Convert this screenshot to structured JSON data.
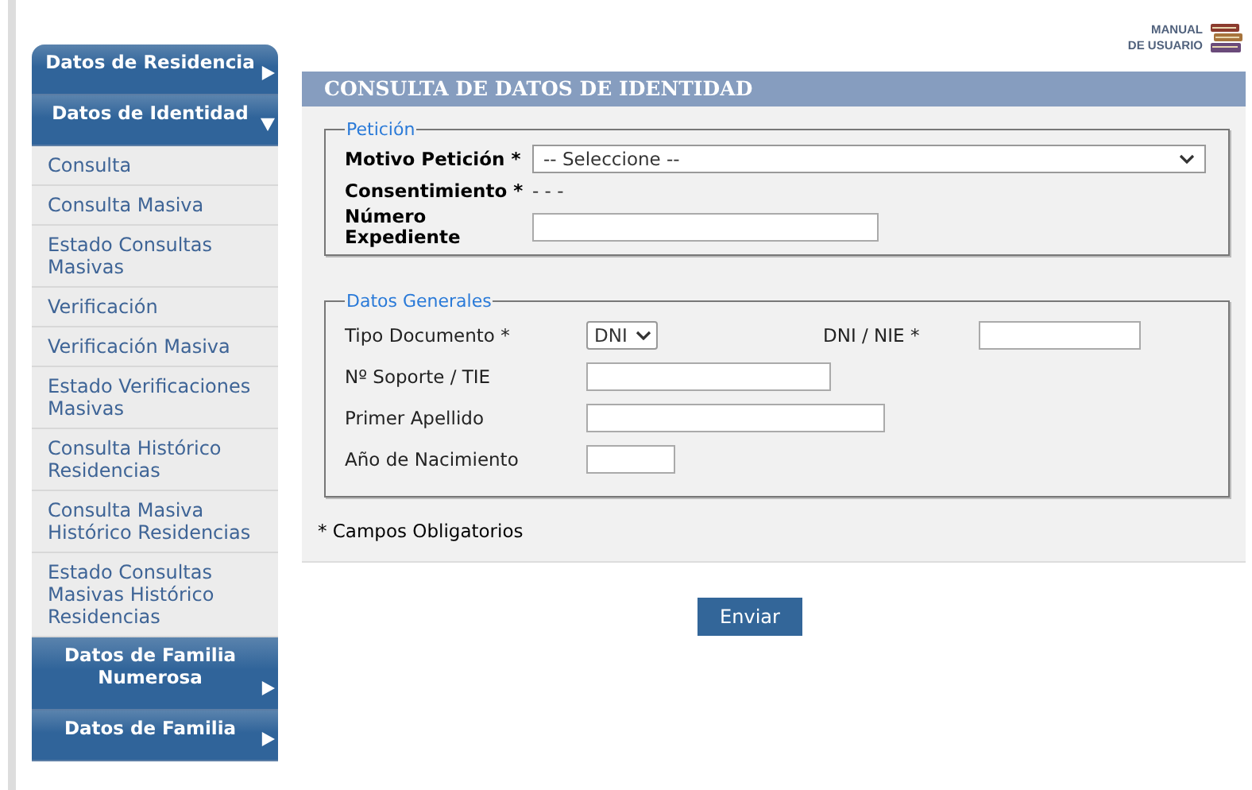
{
  "sidebar": {
    "sections": [
      {
        "title": "Datos de Residencia",
        "expanded": false
      },
      {
        "title": "Datos de Identidad",
        "expanded": true,
        "items": [
          {
            "label": "Consulta"
          },
          {
            "label": "Consulta Masiva"
          },
          {
            "label": "Estado Consultas Masivas"
          },
          {
            "label": "Verificación"
          },
          {
            "label": "Verificación Masiva"
          },
          {
            "label": "Estado Verificaciones Masivas"
          },
          {
            "label": "Consulta Histórico Residencias"
          },
          {
            "label": "Consulta Masiva Histórico Residencias"
          },
          {
            "label": "Estado Consultas Masivas Histórico Residencias"
          }
        ]
      },
      {
        "title": "Datos de Familia Numerosa",
        "expanded": false
      },
      {
        "title": "Datos de Familia",
        "expanded": false
      }
    ]
  },
  "manual_link": {
    "line_1": "MANUAL",
    "line_2": "DE USUARIO"
  },
  "page_title": "CONSULTA DE DATOS DE IDENTIDAD",
  "peticion": {
    "legend": "Petición",
    "motivo": {
      "label": "Motivo Petición *",
      "placeholder": "-- Seleccione --"
    },
    "consentimiento": {
      "label": "Consentimiento *",
      "value": "- - -"
    },
    "expediente": {
      "label": "Número Expediente"
    }
  },
  "datos_generales": {
    "legend": "Datos Generales",
    "tipo_documento": {
      "label": "Tipo Documento *",
      "value": "DNI"
    },
    "dni_nie": {
      "label": "DNI / NIE *"
    },
    "soporte": {
      "label": "Nº Soporte / TIE"
    },
    "apellido": {
      "label": "Primer Apellido"
    },
    "nacimiento": {
      "label": "Año de Nacimiento"
    }
  },
  "required_note": "* Campos Obligatorios",
  "submit_button": "Enviar"
}
